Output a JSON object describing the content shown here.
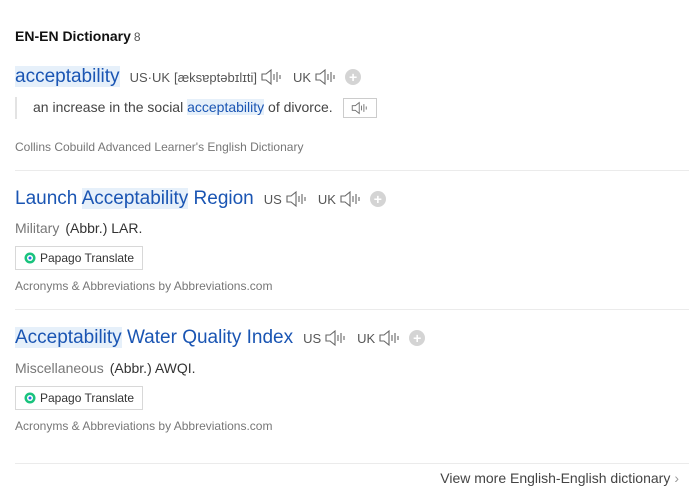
{
  "section": {
    "title": "EN-EN Dictionary",
    "count": "8"
  },
  "entry1": {
    "headword": "acceptability",
    "pron_label": "US·UK",
    "pron_ipa": "[æksɐptəbɪlɪti]",
    "uk_label": "UK",
    "example": {
      "before": "an increase in the social ",
      "highlight": "acceptability",
      "after": " of divorce."
    },
    "source": "Collins Cobuild Advanced Learner's English Dictionary"
  },
  "entry2": {
    "hw_before": "Launch ",
    "hw_highlight": "Acceptability",
    "hw_after": " Region",
    "us_label": "US",
    "uk_label": "UK",
    "category": "Military",
    "meaning": "(Abbr.) LAR.",
    "translate_label": "Papago Translate",
    "source": "Acronyms & Abbreviations by Abbreviations.com"
  },
  "entry3": {
    "hw_highlight": "Acceptability",
    "hw_after": " Water Quality Index",
    "us_label": "US",
    "uk_label": "UK",
    "category": "Miscellaneous",
    "meaning": "(Abbr.) AWQI.",
    "translate_label": "Papago Translate",
    "source": "Acronyms & Abbreviations by Abbreviations.com"
  },
  "footer": {
    "more_label": "View more English-English dictionary",
    "more_icon": "chevron-right-icon"
  },
  "colors": {
    "link": "#1a55b3",
    "highlight_bg": "#e6f0fa",
    "divider": "#ebebeb"
  }
}
